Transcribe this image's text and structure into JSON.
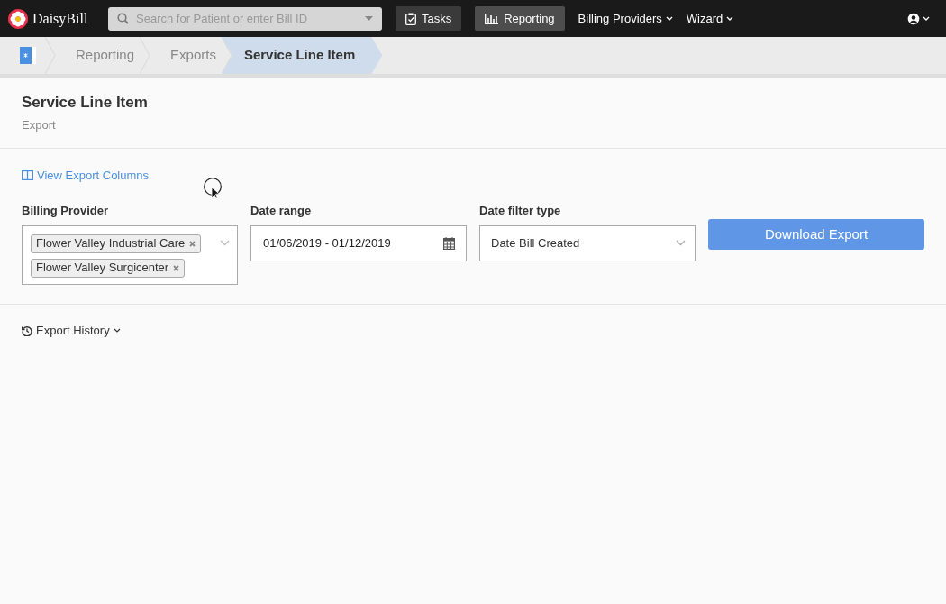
{
  "app": {
    "name": "DaisyBill"
  },
  "search": {
    "placeholder": "Search for Patient or enter Bill ID"
  },
  "nav": [
    {
      "label": "Tasks",
      "kind": "button",
      "selected": false
    },
    {
      "label": "Reporting",
      "kind": "button",
      "selected": true
    },
    {
      "label": "Billing Providers",
      "kind": "dropdown"
    },
    {
      "label": "Wizard",
      "kind": "dropdown"
    }
  ],
  "breadcrumbs": [
    {
      "label": "Reporting",
      "selected": false
    },
    {
      "label": "Exports",
      "selected": false
    },
    {
      "label": "Service Line Item",
      "selected": true
    }
  ],
  "header": {
    "title": "Service Line Item",
    "subtitle": "Export"
  },
  "columns_link": "View Export Columns",
  "form": {
    "billing_provider": {
      "label": "Billing Provider",
      "tags": [
        "Flower Valley Industrial Care",
        "Flower Valley Surgicenter"
      ]
    },
    "date_range": {
      "label": "Date range",
      "value": "01/06/2019 - 01/12/2019"
    },
    "date_filter_type": {
      "label": "Date filter type",
      "value": "Date Bill Created"
    },
    "download_button": "Download Export"
  },
  "history": {
    "label": "Export History"
  }
}
